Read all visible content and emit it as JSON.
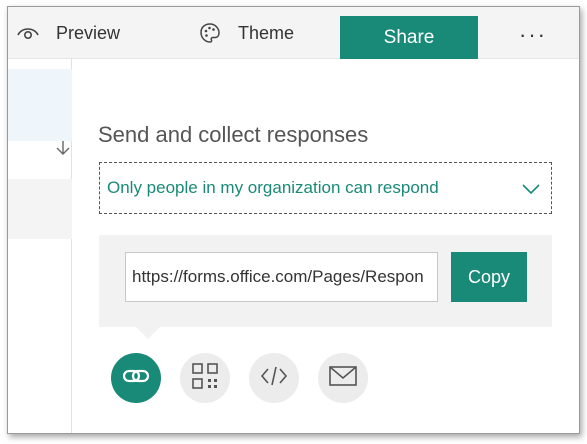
{
  "toolbar": {
    "preview_label": "Preview",
    "theme_label": "Theme",
    "share_label": "Share",
    "more_label": "···"
  },
  "panel": {
    "title": "Send and collect responses",
    "permission_selected": "Only people in my organization can respond",
    "link_value": "https://forms.office.com/Pages/Respon",
    "copy_label": "Copy"
  },
  "share_options": [
    {
      "icon": "link-icon",
      "selected": true
    },
    {
      "icon": "qr-code-icon",
      "selected": false
    },
    {
      "icon": "embed-icon",
      "selected": false
    },
    {
      "icon": "email-icon",
      "selected": false
    }
  ],
  "colors": {
    "accent": "#1a8a78",
    "toolbar_bg": "#f4f4f4",
    "option_bg": "#ececec",
    "link_panel_bg": "#f2f2f2"
  }
}
